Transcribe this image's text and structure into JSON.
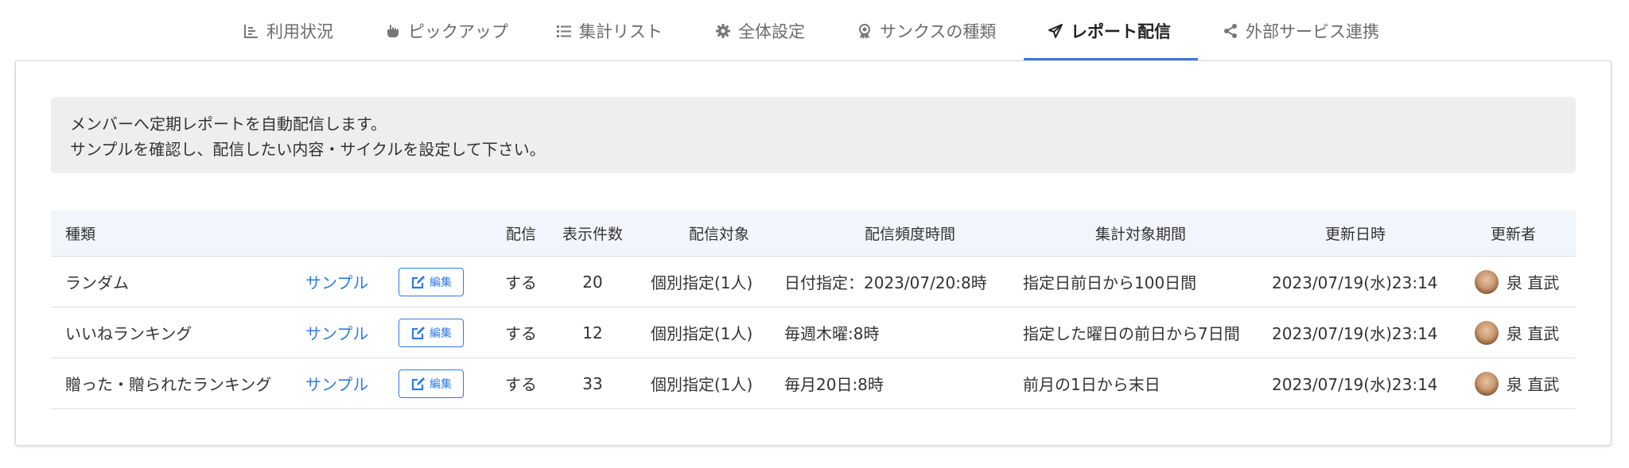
{
  "tabs": [
    {
      "label": "利用状況",
      "icon": "bar-list-icon"
    },
    {
      "label": "ピックアップ",
      "icon": "hand-pointer-icon"
    },
    {
      "label": "集計リスト",
      "icon": "list-icon"
    },
    {
      "label": "全体設定",
      "icon": "gear-icon"
    },
    {
      "label": "サンクスの種類",
      "icon": "award-icon"
    },
    {
      "label": "レポート配信",
      "icon": "paper-plane-icon",
      "active": true
    },
    {
      "label": "外部サービス連携",
      "icon": "share-icon"
    }
  ],
  "notice": {
    "line1": "メンバーへ定期レポートを自動配信します。",
    "line2": "サンプルを確認し、配信したい内容・サイクルを設定して下さい。"
  },
  "table": {
    "headers": {
      "type": "種類",
      "delivery": "配信",
      "count": "表示件数",
      "target": "配信対象",
      "frequency": "配信頻度時間",
      "period": "集計対象期間",
      "updated": "更新日時",
      "updater": "更新者"
    },
    "rows": [
      {
        "type": "ランダム",
        "sample": "サンプル",
        "edit": "編集",
        "delivery": "する",
        "count": "20",
        "target": "個別指定(1人)",
        "frequency": "日付指定：2023/07/20:8時",
        "period": "指定日前日から100日間",
        "updated": "2023/07/19(水)23:14",
        "updater": "泉 直武"
      },
      {
        "type": "いいねランキング",
        "sample": "サンプル",
        "edit": "編集",
        "delivery": "する",
        "count": "12",
        "target": "個別指定(1人)",
        "frequency": "毎週木曜:8時",
        "period": "指定した曜日の前日から7日間",
        "updated": "2023/07/19(水)23:14",
        "updater": "泉 直武"
      },
      {
        "type": "贈った・贈られたランキング",
        "sample": "サンプル",
        "edit": "編集",
        "delivery": "する",
        "count": "33",
        "target": "個別指定(1人)",
        "frequency": "毎月20日:8時",
        "period": "前月の1日から末日",
        "updated": "2023/07/19(水)23:14",
        "updater": "泉 直武"
      }
    ]
  },
  "colors": {
    "accent": "#2f7be5",
    "tab_underline": "#3d7be6",
    "header_bg": "#f1f6fc",
    "notice_bg": "#eeeeee"
  }
}
